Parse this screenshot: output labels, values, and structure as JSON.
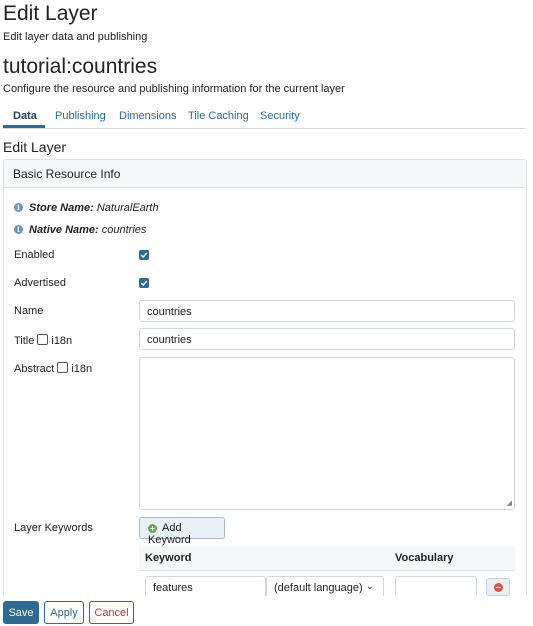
{
  "header": {
    "title": "Edit Layer",
    "subtitle": "Edit layer data and publishing",
    "layer_name": "tutorial:countries",
    "layer_description": "Configure the resource and publishing information for the current layer"
  },
  "tabs": [
    {
      "label": "Data",
      "active": true
    },
    {
      "label": "Publishing"
    },
    {
      "label": "Dimensions"
    },
    {
      "label": "Tile Caching"
    },
    {
      "label": "Security"
    }
  ],
  "section_title": "Edit Layer",
  "panel": {
    "title": "Basic Resource Info",
    "store_label": "Store Name:",
    "store_value": "NaturalEarth",
    "native_label": "Native Name:",
    "native_value": "countries",
    "enabled_label": "Enabled",
    "enabled_checked": true,
    "advertised_label": "Advertised",
    "advertised_checked": true,
    "name_label": "Name",
    "name_value": "countries",
    "title_label": "Title",
    "title_i18n": "i18n",
    "title_value": "countries",
    "abstract_label": "Abstract",
    "abstract_i18n": "i18n",
    "abstract_value": "",
    "keywords_label": "Layer Keywords",
    "add_keyword_label": "Add Keyword",
    "keyword_col": "Keyword",
    "vocabulary_col": "Vocabulary",
    "keyword_value": "features",
    "language_value": "(default language)",
    "vocabulary_value": ""
  },
  "footer": {
    "save": "Save",
    "apply": "Apply",
    "cancel": "Cancel"
  },
  "colors": {
    "accent": "#2e6a93",
    "cancel": "#c9302c",
    "add_icon": "#6aa84f",
    "remove_icon": "#d9534f"
  }
}
